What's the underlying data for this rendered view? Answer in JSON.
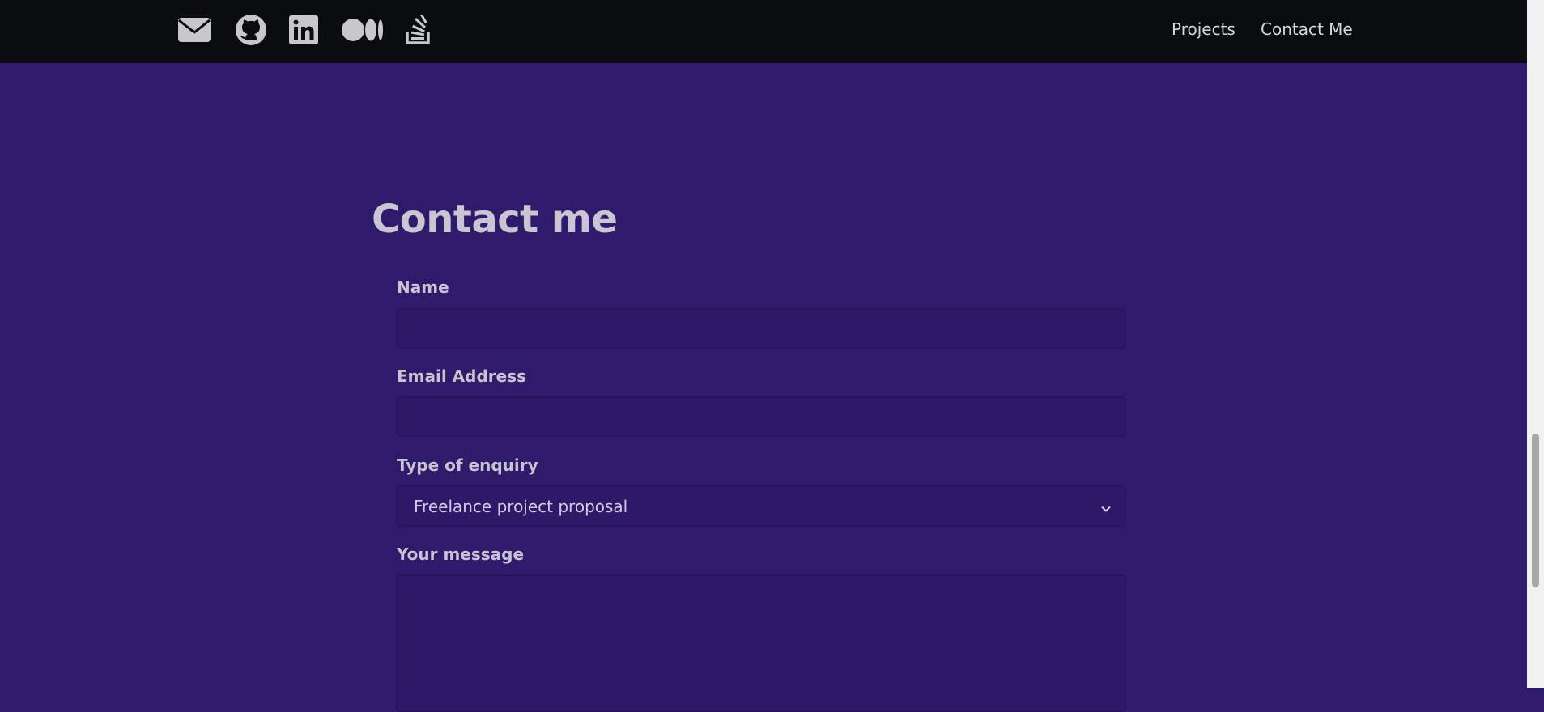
{
  "header": {
    "social_icons": [
      "email-icon",
      "github-icon",
      "linkedin-icon",
      "medium-icon",
      "stackoverflow-icon"
    ],
    "nav": {
      "projects": "Projects",
      "contact": "Contact Me"
    }
  },
  "form": {
    "title": "Contact me",
    "name_label": "Name",
    "name_value": "",
    "email_label": "Email Address",
    "email_value": "",
    "enquiry_label": "Type of enquiry",
    "enquiry_selected": "Freelance project proposal",
    "message_label": "Your message",
    "message_value": ""
  },
  "colors": {
    "background": "#301a6b",
    "header": "#0b0c0f",
    "text": "#c9c5d2"
  }
}
